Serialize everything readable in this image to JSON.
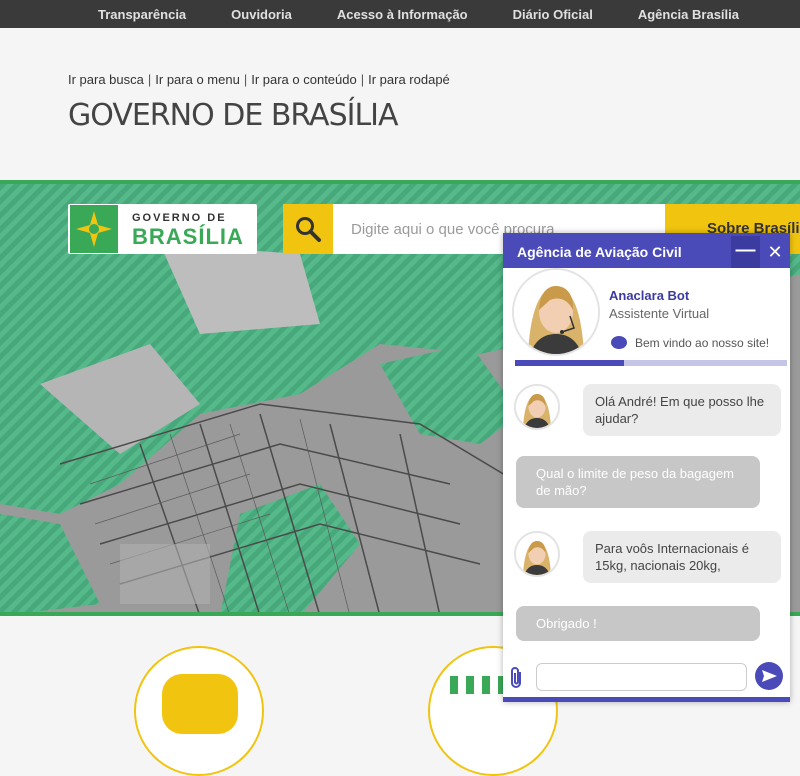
{
  "topnav": [
    "Transparência",
    "Ouvidoria",
    "Acesso à Informação",
    "Diário Oficial",
    "Agência Brasília"
  ],
  "skip_links": [
    "Ir para busca",
    "Ir para o menu",
    "Ir para o conteúdo",
    "Ir para rodapé"
  ],
  "skip_sep": "|",
  "page_title": "GOVERNO DE BRASÍLIA",
  "logo": {
    "line1": "GOVERNO DE",
    "line2": "BRASÍLIA"
  },
  "search": {
    "placeholder": "Digite aqui o que você procura",
    "icon": "search-icon"
  },
  "sobre_label": "Sobre Brasília",
  "colors": {
    "green": "#3aa957",
    "yellow": "#f1c40f",
    "chat_blue": "#4a4ab8",
    "topbar": "#3a3a3a"
  },
  "chat": {
    "title": "Agência de Aviação Civil",
    "minimize": "—",
    "close": "✕",
    "bot_name": "Anaclara Bot",
    "bot_role": "Assistente Virtual",
    "welcome": "Bem vindo ao nosso site!",
    "progress": 0.4,
    "messages": [
      {
        "from": "bot",
        "text": "Olá André! Em que posso lhe ajudar?"
      },
      {
        "from": "user",
        "text": "Qual o limite de peso da bagagem de mão?"
      },
      {
        "from": "bot",
        "text": "Para voôs Internacionais é 15kg, nacionais 20kg,"
      },
      {
        "from": "user",
        "text": "Obrigado !"
      }
    ],
    "input_placeholder": ""
  }
}
